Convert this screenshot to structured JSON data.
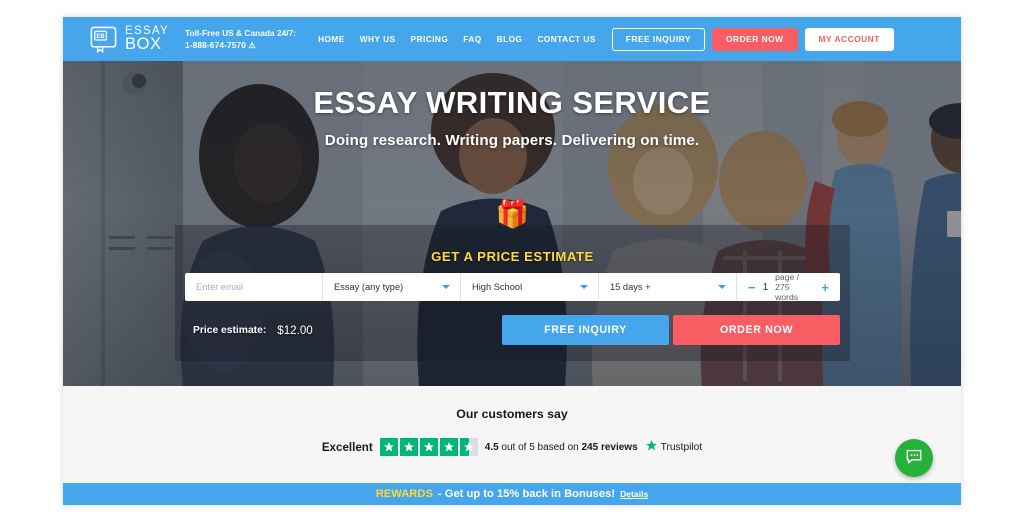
{
  "header": {
    "logo": {
      "line1": "ESSAY",
      "line2": "BOX",
      "mark": "EB",
      "icon": "book-icon"
    },
    "phone": {
      "label": "Toll-Free US & Canada 24/7:",
      "number": "1-888-674-7570",
      "icon": "warning-icon"
    },
    "nav": [
      {
        "label": "HOME"
      },
      {
        "label": "WHY US"
      },
      {
        "label": "PRICING"
      },
      {
        "label": "FAQ"
      },
      {
        "label": "BLOG"
      },
      {
        "label": "CONTACT US"
      }
    ],
    "buttons": {
      "free_inquiry": "FREE INQUIRY",
      "order_now": "ORDER NOW",
      "my_account": "MY ACCOUNT"
    },
    "bg_color": "#45a6ec",
    "accent_red": "#f95d64"
  },
  "hero": {
    "title": "ESSAY WRITING SERVICE",
    "subtitle": "Doing research. Writing papers. Delivering on time."
  },
  "calculator": {
    "gift_icon": "gift-icon",
    "title": "GET A PRICE ESTIMATE",
    "email_placeholder": "Enter email",
    "email_value": "",
    "paper_type": "Essay (any type)",
    "academic_level": "High School",
    "deadline": "15 days +",
    "pages_value": "1",
    "pages_label": "page / 275 words",
    "minus": "−",
    "plus": "+",
    "price_label": "Price estimate:",
    "price_value": "$12.00",
    "free_inquiry": "FREE INQUIRY",
    "order_now": "ORDER NOW",
    "title_color": "#ffd83b"
  },
  "reviews": {
    "heading": "Our customers say",
    "rating_word": "Excellent",
    "score": "4.5",
    "of_text": " out of 5 based on ",
    "reviews_count": "245 reviews",
    "brand": "Trustpilot",
    "stars_filled": 4,
    "stars_half": 1,
    "star_color": "#00b67a"
  },
  "rewards": {
    "gold": "REWARDS",
    "main": "- Get up to 15% back in Bonuses!",
    "details": "Details"
  },
  "chat": {
    "icon": "chat-bubble-icon"
  }
}
